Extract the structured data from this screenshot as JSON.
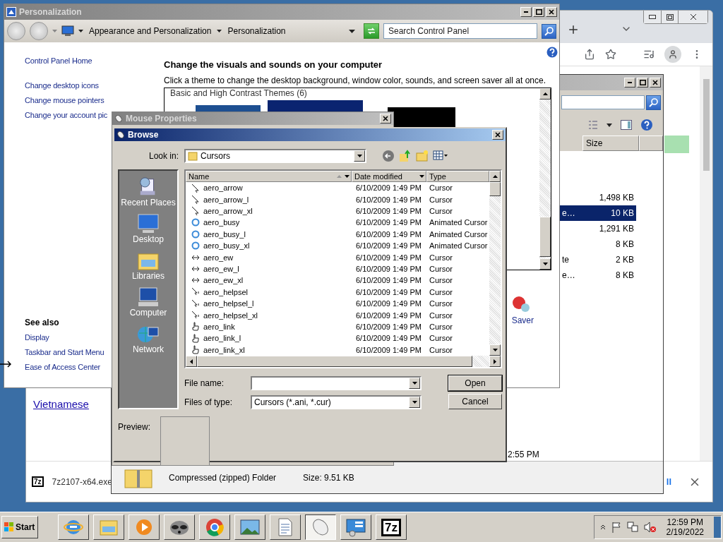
{
  "chrome": {
    "page_link": "Vietnamese",
    "download": {
      "badge": "7z",
      "file": "7z2107-x64.exe",
      "show_all": "ll"
    }
  },
  "explorer": {
    "column": "Size",
    "rows": [
      {
        "size": "1,498 KB",
        "selected": false
      },
      {
        "name": "e…",
        "size": "10 KB",
        "selected": true
      },
      {
        "size": "1,291 KB",
        "selected": false
      },
      {
        "size": "8 KB",
        "selected": false
      },
      {
        "name": "te",
        "size": "2 KB",
        "selected": false
      },
      {
        "name": "e…",
        "size": "8 KB",
        "selected": false
      }
    ],
    "time": "2:55 PM",
    "details": {
      "type": "Compressed (zipped) Folder",
      "size": "Size: 9.51 KB"
    }
  },
  "personalization": {
    "title": "Personalization",
    "breadcrumb": [
      "Appearance and Personalization",
      "Personalization"
    ],
    "search": {
      "placeholder": "Search Control Panel"
    },
    "tasks": [
      "Control Panel Home",
      "Change desktop icons",
      "Change mouse pointers",
      "Change your account pic"
    ],
    "see_also": {
      "heading": "See also",
      "links": [
        "Display",
        "Taskbar and Start Menu",
        "Ease of Access Center"
      ]
    },
    "heading": "Change the visuals and sounds on your computer",
    "description": "Click a theme to change the desktop background, window color, sounds, and screen saver all at once.",
    "theme_group": "Basic and High Contrast Themes (6)",
    "screen_saver": "Saver"
  },
  "mouse_properties": {
    "title": "Mouse Properties"
  },
  "browse": {
    "title": "Browse",
    "look_in": {
      "label": "Look in:",
      "value": "Cursors"
    },
    "places": [
      {
        "kind": "recent",
        "label": "Recent Places"
      },
      {
        "kind": "desktop",
        "label": "Desktop"
      },
      {
        "kind": "libraries",
        "label": "Libraries"
      },
      {
        "kind": "computer",
        "label": "Computer"
      },
      {
        "kind": "network",
        "label": "Network"
      }
    ],
    "columns": [
      "Name",
      "Date modified",
      "Type"
    ],
    "files": [
      {
        "kind": "arrow",
        "name": "aero_arrow",
        "date": "6/10/2009 1:49 PM",
        "type": "Cursor"
      },
      {
        "kind": "arrow",
        "name": "aero_arrow_l",
        "date": "6/10/2009 1:49 PM",
        "type": "Cursor"
      },
      {
        "kind": "arrow",
        "name": "aero_arrow_xl",
        "date": "6/10/2009 1:49 PM",
        "type": "Cursor"
      },
      {
        "kind": "busy",
        "name": "aero_busy",
        "date": "6/10/2009 1:49 PM",
        "type": "Animated Cursor"
      },
      {
        "kind": "busy",
        "name": "aero_busy_l",
        "date": "6/10/2009 1:49 PM",
        "type": "Animated Cursor"
      },
      {
        "kind": "busy",
        "name": "aero_busy_xl",
        "date": "6/10/2009 1:49 PM",
        "type": "Animated Cursor"
      },
      {
        "kind": "ew",
        "name": "aero_ew",
        "date": "6/10/2009 1:49 PM",
        "type": "Cursor"
      },
      {
        "kind": "ew",
        "name": "aero_ew_l",
        "date": "6/10/2009 1:49 PM",
        "type": "Cursor"
      },
      {
        "kind": "ew",
        "name": "aero_ew_xl",
        "date": "6/10/2009 1:49 PM",
        "type": "Cursor"
      },
      {
        "kind": "helpsel",
        "name": "aero_helpsel",
        "date": "6/10/2009 1:49 PM",
        "type": "Cursor"
      },
      {
        "kind": "helpsel",
        "name": "aero_helpsel_l",
        "date": "6/10/2009 1:49 PM",
        "type": "Cursor"
      },
      {
        "kind": "helpsel",
        "name": "aero_helpsel_xl",
        "date": "6/10/2009 1:49 PM",
        "type": "Cursor"
      },
      {
        "kind": "link",
        "name": "aero_link",
        "date": "6/10/2009 1:49 PM",
        "type": "Cursor"
      },
      {
        "kind": "link",
        "name": "aero_link_l",
        "date": "6/10/2009 1:49 PM",
        "type": "Cursor"
      },
      {
        "kind": "link",
        "name": "aero_link_xl",
        "date": "6/10/2009 1:49 PM",
        "type": "Cursor"
      }
    ],
    "file_name": {
      "label": "File name:"
    },
    "file_type": {
      "label": "Files of type:",
      "value": "Cursors (*.ani, *.cur)"
    },
    "buttons": [
      "Open",
      "Cancel"
    ],
    "preview": "Preview:"
  },
  "taskbar": {
    "start": "Start",
    "apps": [
      {
        "kind": "ie",
        "selected": false
      },
      {
        "kind": "explorer",
        "selected": false
      },
      {
        "kind": "media",
        "selected": false
      },
      {
        "kind": "raccoon",
        "selected": false
      },
      {
        "kind": "chrome",
        "selected": false
      },
      {
        "kind": "photo",
        "selected": false
      },
      {
        "kind": "document",
        "selected": false
      },
      {
        "kind": "mouse",
        "selected": true
      },
      {
        "kind": "controlpanel",
        "selected": false
      },
      {
        "kind": "sevenzip",
        "badge": "7z",
        "selected": false
      }
    ],
    "time": "12:59 PM",
    "date": "2/19/2022"
  }
}
